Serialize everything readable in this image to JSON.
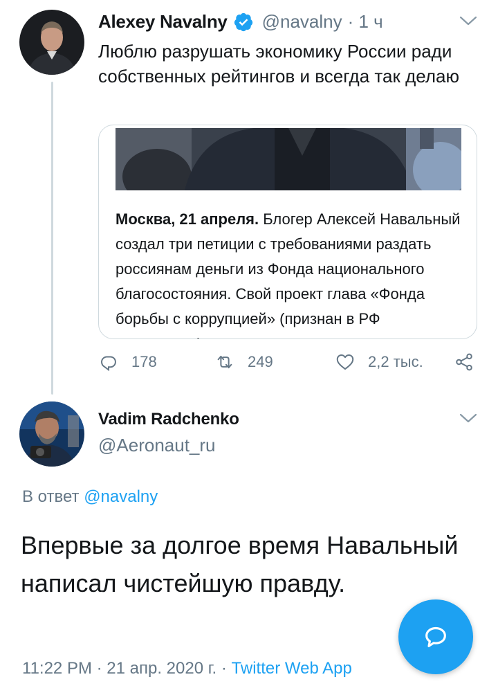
{
  "colors": {
    "accent": "#1da1f2",
    "secondary_text": "#657786",
    "primary_text": "#14171a",
    "border": "#cfd9de"
  },
  "original_tweet": {
    "display_name": "Alexey Navalny",
    "verified_icon": "verified-badge-icon",
    "handle": "@navalny",
    "time": "· 1 ч",
    "text": "Люблю разрушать экономику России ради собственных рейтингов и всегда так делаю",
    "card": {
      "lead": "Москва, 21 апреля.",
      "body": " Блогер Алексей Навальный создал три петиции с требованиями раздать россиянам деньги из Фонда национального благосостояния. Свой проект глава «Фонда борьбы с коррупцией» (признан в РФ иноагентом)"
    },
    "actions": {
      "reply_count": "178",
      "retweet_count": "249",
      "like_count": "2,2 тыс."
    }
  },
  "reply_tweet": {
    "display_name": "Vadim Radchenko",
    "handle": "@Aeronaut_ru",
    "in_reply_prefix": "В ответ ",
    "in_reply_mention": "@navalny",
    "text": "Впервые за долгое время Навальный написал чистейшую правду.",
    "timestamp": "11:22 PM · 21 апр. 2020 г. · ",
    "source_app": "Twitter Web App"
  }
}
